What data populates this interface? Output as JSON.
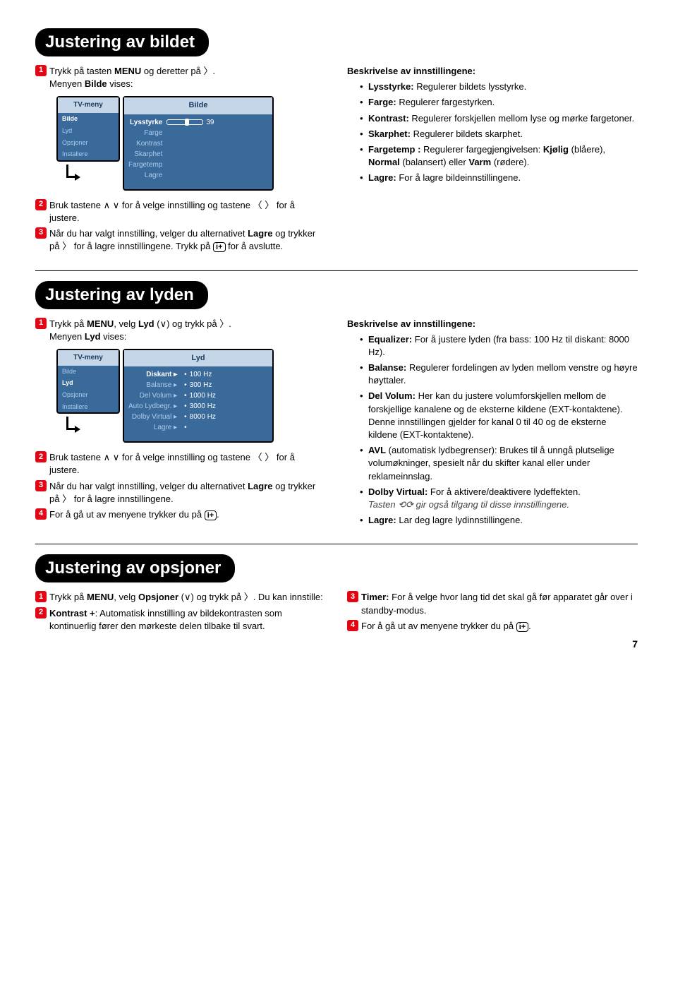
{
  "section1": {
    "header": "Justering av bildet",
    "left": {
      "n1": "Trykk på tasten",
      "menu": "MENU",
      "afterMenu": "og deretter på",
      "dot": ".",
      "line2a": "Menyen",
      "bilde": "Bilde",
      "line2b": "vises:",
      "tv": {
        "leftTitle": "TV-meny",
        "leftItems": [
          "Bilde",
          "Lyd",
          "Opsjoner",
          "Installere"
        ],
        "rightTitle": "Bilde",
        "labels": [
          "Lysstyrke",
          "Farge",
          "Kontrast",
          "Skarphet",
          "Fargetemp",
          "Lagre"
        ],
        "value39": "39"
      },
      "n2a": "Bruk tastene",
      "n2b": "for å velge innstilling og tastene",
      "n2c": "for å justere.",
      "n3a": "Når du har valgt innstilling, velger du alternativet",
      "lagre": "Lagre",
      "n3b": "og trykker på",
      "n3c": "for å lagre innstillingene. Trykk på",
      "n3d": "for å avslutte."
    },
    "right": {
      "head": "Beskrivelse av innstillingene:",
      "items": [
        {
          "label": "Lysstyrke:",
          "text": "Regulerer bildets lysstyrke."
        },
        {
          "label": "Farge:",
          "text": "Regulerer fargestyrken."
        },
        {
          "label": "Kontrast:",
          "text": "Regulerer forskjellen mellom lyse og mørke fargetoner."
        },
        {
          "label": "Skarphet:",
          "text": "Regulerer bildets skarphet."
        }
      ],
      "fargetemp": {
        "label": "Fargetemp :",
        "t1": "Regulerer fargegjengivelsen:",
        "kjolig": "Kjølig",
        "t2": "(blåere),",
        "normal": "Normal",
        "t3": "(balansert) eller",
        "varm": "Varm",
        "t4": "(rødere)."
      },
      "lagre": {
        "label": "Lagre:",
        "text": "For å lagre bildeinnstillingene."
      }
    }
  },
  "section2": {
    "header": "Justering av lyden",
    "left": {
      "n1a": "Trykk på",
      "menu": "MENU",
      "n1b": ", velg",
      "lyd": "Lyd",
      "n1c": "(",
      "n1d": ") og trykk på",
      "dot": ".",
      "line2a": "Menyen",
      "line2b": "vises:",
      "tv": {
        "leftTitle": "TV-meny",
        "leftItems": [
          "Bilde",
          "Lyd",
          "Opsjoner",
          "Installere"
        ],
        "rightTitle": "Lyd",
        "rows": [
          {
            "label": "Diskant",
            "arrow": "▸",
            "dot": "•",
            "val": "100 Hz"
          },
          {
            "label": "Balanse",
            "arrow": "▸",
            "dot": "•",
            "val": "300 Hz"
          },
          {
            "label": "Del Volum",
            "arrow": "▸",
            "dot": "•",
            "val": "1000 Hz"
          },
          {
            "label": "Auto Lydbegr.",
            "arrow": "▸",
            "dot": "•",
            "val": "3000 Hz"
          },
          {
            "label": "Dolby Virtual",
            "arrow": "▸",
            "dot": "•",
            "val": "8000 Hz"
          },
          {
            "label": "Lagre",
            "arrow": "▸",
            "dot": "•",
            "val": ""
          }
        ]
      },
      "n2a": "Bruk tastene",
      "n2b": "for å velge innstilling og tastene",
      "n2c": "for å justere.",
      "n3a": "Når du har valgt innstilling, velger du alternativet",
      "lagre": "Lagre",
      "n3b": "og trykker på",
      "n3c": "for å lagre innstillingene.",
      "n4a": "For å gå ut av menyene trykker du på",
      "n4b": "."
    },
    "right": {
      "head": "Beskrivelse av innstillingene:",
      "eq": {
        "label": "Equalizer:",
        "text": "For å justere lyden (fra bass: 100 Hz til diskant: 8000 Hz)."
      },
      "bal": {
        "label": "Balanse:",
        "text": "Regulerer fordelingen av lyden mellom venstre og høyre høyttaler."
      },
      "delv": {
        "label": "Del Volum:",
        "text": "Her kan du justere volumforskjellen mellom de forskjellige kanalene og de eksterne kildene (EXT-kontaktene). Denne innstillingen gjelder for kanal 0 til 40 og de eksterne kildene (EXT-kontaktene)."
      },
      "avl": {
        "label": "AVL",
        "text": "(automatisk lydbegrenser): Brukes til å unngå plutselige volumøkninger, spesielt når du skifter kanal eller under reklameinnslag."
      },
      "dolby": {
        "label": "Dolby Virtual:",
        "text": "For å aktivere/deaktivere lydeffekten."
      },
      "note1": "Tasten",
      "note2": "gir også tilgang til disse innstillingene.",
      "lag": {
        "label": "Lagre:",
        "text": "Lar deg lagre lydinnstillingene."
      }
    }
  },
  "section3": {
    "header": "Justering av opsjoner",
    "left": {
      "n1a": "Trykk på",
      "menu": "MENU",
      "n1b": ", velg",
      "opsjoner": "Opsjoner",
      "n1c": "(",
      "n1d": ") og trykk på",
      "n1e": ". Du kan innstille:",
      "n2label": "Kontrast +",
      "n2text": ": Automatisk innstilling av bildekontrasten som kontinuerlig fører den mørkeste delen tilbake til svart."
    },
    "right": {
      "n3label": "Timer:",
      "n3text": "For å velge hvor lang tid det skal gå før apparatet går over i standby-modus.",
      "n4a": "For å gå ut av menyene trykker du på",
      "n4b": "."
    }
  },
  "pageNum": "7",
  "n1": "1",
  "n2": "2",
  "n3": "3",
  "n4": "4",
  "iplus": "i+"
}
